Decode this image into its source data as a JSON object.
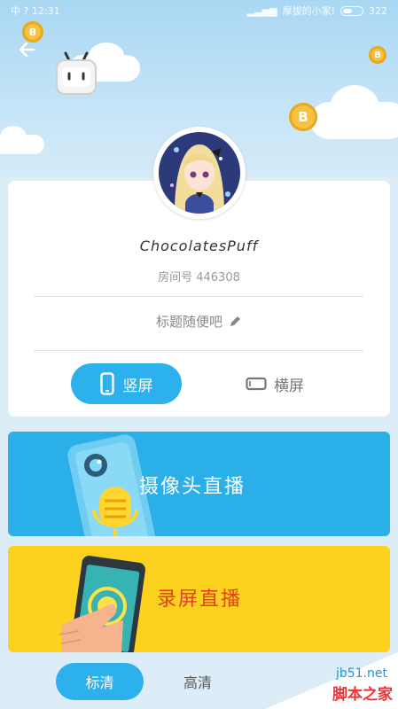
{
  "status_bar": {
    "time": "中 ? 12:31",
    "carrier": "摩拔的小家!",
    "battery": "322"
  },
  "icons": {
    "back": "back-arrow-icon",
    "edit": "pencil-icon",
    "portrait": "phone-portrait-icon",
    "landscape": "phone-landscape-icon",
    "coin": "coin-icon",
    "mascot": "tv-mascot-icon"
  },
  "profile": {
    "name": "ChocolatesPuff",
    "room_label": "房间号 446308",
    "title": "标题随便吧"
  },
  "orientation": {
    "portrait_label": "竖屏",
    "landscape_label": "横屏",
    "selected": "portrait"
  },
  "modes": {
    "camera_label": "摄像头直播",
    "screen_label": "录屏直播"
  },
  "quality": {
    "standard_label": "标清",
    "high_label": "高清",
    "selected": "standard"
  },
  "watermark": {
    "site": "jb51.net",
    "name": "脚本之家"
  },
  "colors": {
    "accent": "#2db1ec",
    "camera_panel": "#2aafe9",
    "screen_panel": "#fdd21e",
    "coin": "#f5c242",
    "screen_text": "#e0401f"
  }
}
